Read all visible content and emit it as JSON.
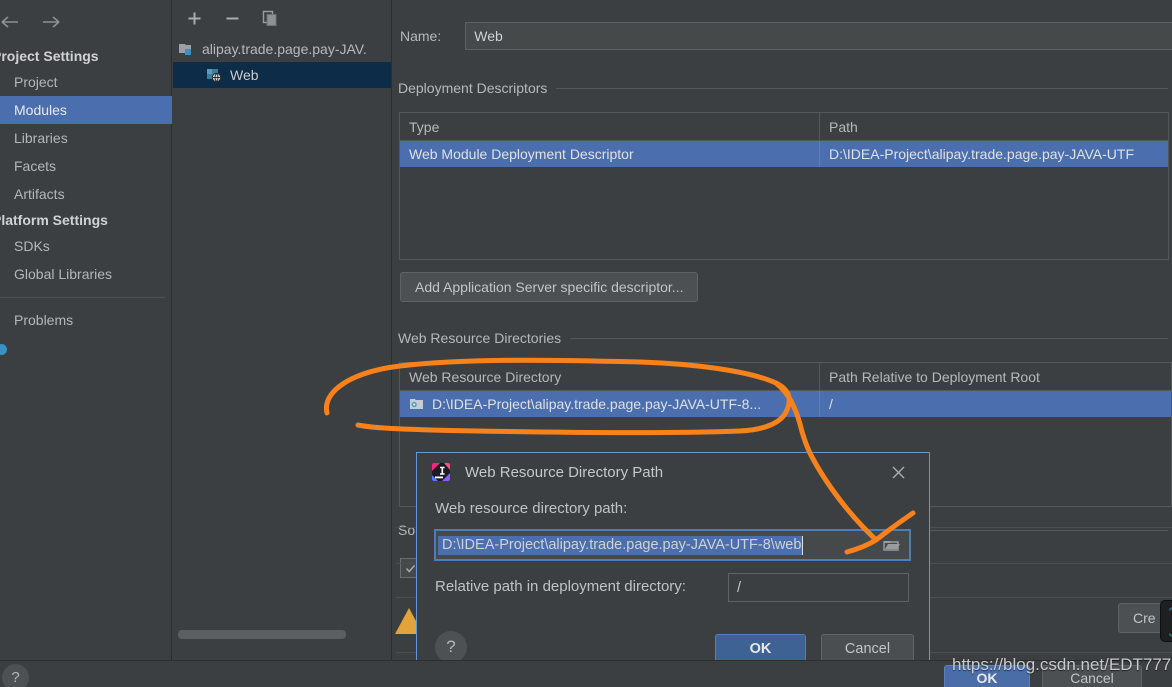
{
  "nav": {
    "back_icon": "arrow-left-icon",
    "forward_icon": "arrow-right-icon"
  },
  "sidebar": {
    "groups": [
      {
        "label": "Project Settings",
        "items": [
          {
            "label": "Project",
            "selected": false
          },
          {
            "label": "Modules",
            "selected": true
          },
          {
            "label": "Libraries",
            "selected": false
          },
          {
            "label": "Facets",
            "selected": false
          },
          {
            "label": "Artifacts",
            "selected": false
          }
        ]
      },
      {
        "label": "Platform Settings",
        "items": [
          {
            "label": "SDKs",
            "selected": false
          },
          {
            "label": "Global Libraries",
            "selected": false
          }
        ]
      }
    ],
    "problems": {
      "label": "Problems",
      "badge_color": "#3592c4"
    }
  },
  "modules_panel": {
    "toolbar": [
      {
        "name": "add-module-button",
        "glyph": "+"
      },
      {
        "name": "remove-module-button",
        "glyph": "−"
      },
      {
        "name": "copy-module-button",
        "glyph": "copy-icon"
      }
    ],
    "tree": [
      {
        "label": "alipay.trade.page.pay-JAV.",
        "icon": "module-folder-icon",
        "level": 0,
        "selected": false
      },
      {
        "label": "Web",
        "icon": "web-facet-icon",
        "level": 1,
        "selected": true
      }
    ]
  },
  "main": {
    "name_label": "Name:",
    "name_value": "Web",
    "deployment_descriptors": {
      "title": "Deployment Descriptors",
      "columns": [
        "Type",
        "Path"
      ],
      "rows": [
        {
          "type": "Web Module Deployment Descriptor",
          "path": "D:\\IDEA-Project\\alipay.trade.page.pay-JAVA-UTF",
          "selected": true
        }
      ],
      "add_button": "Add Application Server specific descriptor..."
    },
    "web_resource_directories": {
      "title": "Web Resource Directories",
      "columns": [
        "Web Resource Directory",
        "Path Relative to Deployment Root"
      ],
      "rows": [
        {
          "directory": "D:\\IDEA-Project\\alipay.trade.page.pay-JAVA-UTF-8...",
          "relative": "/",
          "icon": "folder-web-icon",
          "selected": true
        }
      ]
    },
    "source_roots_title": "So",
    "create_button": "Cre",
    "selection_color": "#4b6eaf"
  },
  "dialog": {
    "title": "Web Resource Directory Path",
    "logo_icon": "intellij-idea-logo-icon",
    "close_icon": "close-icon",
    "path_label": "Web resource directory path:",
    "path_value": "D:\\IDEA-Project\\alipay.trade.page.pay-JAVA-UTF-8\\web",
    "browse_icon": "folder-browse-icon",
    "relative_label": "Relative path in deployment directory:",
    "relative_value": "/",
    "help_glyph": "?",
    "ok_label": "OK",
    "cancel_label": "Cancel",
    "border_color": "#6897d0"
  },
  "bottom_bar": {
    "help_glyph": "?",
    "ok_label": "OK",
    "cancel_label": "Cancel"
  },
  "watermark": "https://blog.csdn.net/EDT777",
  "annotation": {
    "color": "#f7821b",
    "stroke": 5
  }
}
